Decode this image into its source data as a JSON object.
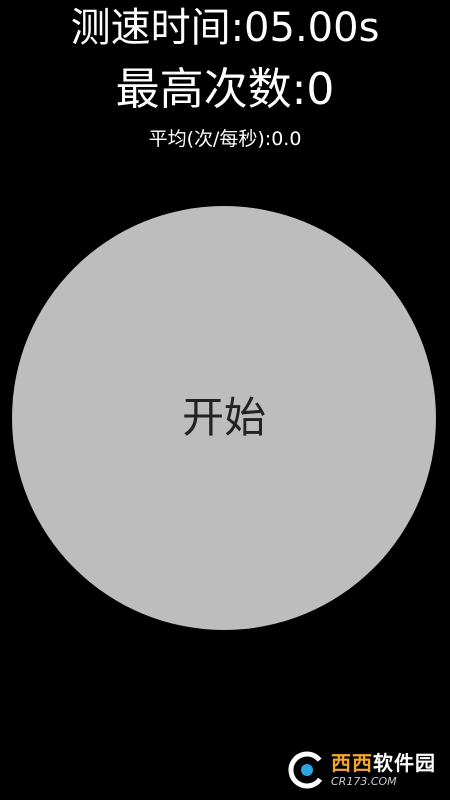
{
  "header": {
    "timer_text": "测速时间:05.00s",
    "best_text": "最高次数:0",
    "average_text": "平均(次/每秒):0.0"
  },
  "button": {
    "label": "开始",
    "color": "#bdbdbd"
  },
  "watermark": {
    "brand_accent": "西西",
    "brand_rest": "软件园",
    "url": "CR173.COM"
  }
}
